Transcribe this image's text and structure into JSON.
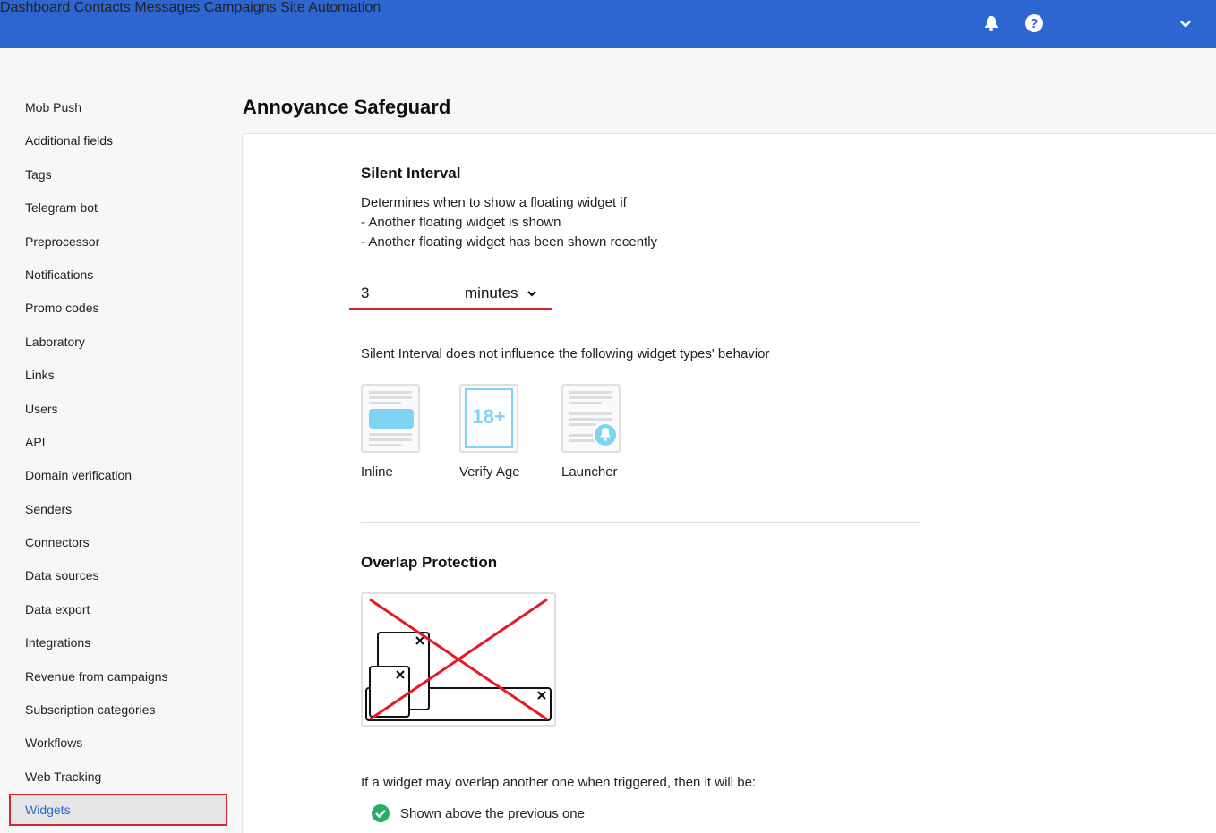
{
  "nav": {
    "items": [
      "Dashboard",
      "Contacts",
      "Messages",
      "Campaigns",
      "Site",
      "Automation"
    ],
    "icons": [
      "bell-icon",
      "help-icon",
      "chevron-down-icon"
    ],
    "color": "#2d66d1"
  },
  "sidebar": {
    "items": [
      "Mob Push",
      "Additional fields",
      "Tags",
      "Telegram bot",
      "Preprocessor",
      "Notifications",
      "Promo codes",
      "Laboratory",
      "Links",
      "Users",
      "API",
      "Domain verification",
      "Senders",
      "Connectors",
      "Data sources",
      "Data export",
      "Integrations",
      "Revenue from campaigns",
      "Subscription categories",
      "Workflows",
      "Web Tracking",
      "Widgets"
    ],
    "active": "Widgets"
  },
  "page": {
    "title": "Annoyance Safeguard"
  },
  "silent_interval": {
    "heading": "Silent Interval",
    "desc_line1": "Determines when to show a floating widget if",
    "desc_line2": "- Another floating widget is shown",
    "desc_line3": "- Another floating widget has been shown recently",
    "value": "3",
    "unit": "minutes",
    "note": "Silent Interval does not influence the following widget types' behavior",
    "widget_types": [
      "Inline",
      "Verify Age",
      "Launcher"
    ],
    "verify_age_badge": "18+"
  },
  "overlap": {
    "heading": "Overlap Protection",
    "desc": "If a widget may overlap another one when triggered, then it will be:",
    "option1": "Shown above the previous one"
  },
  "colors": {
    "accent": "#2d66d1",
    "error": "#d6232f",
    "success": "#27ae60",
    "cyan": "#7fd3f5"
  }
}
